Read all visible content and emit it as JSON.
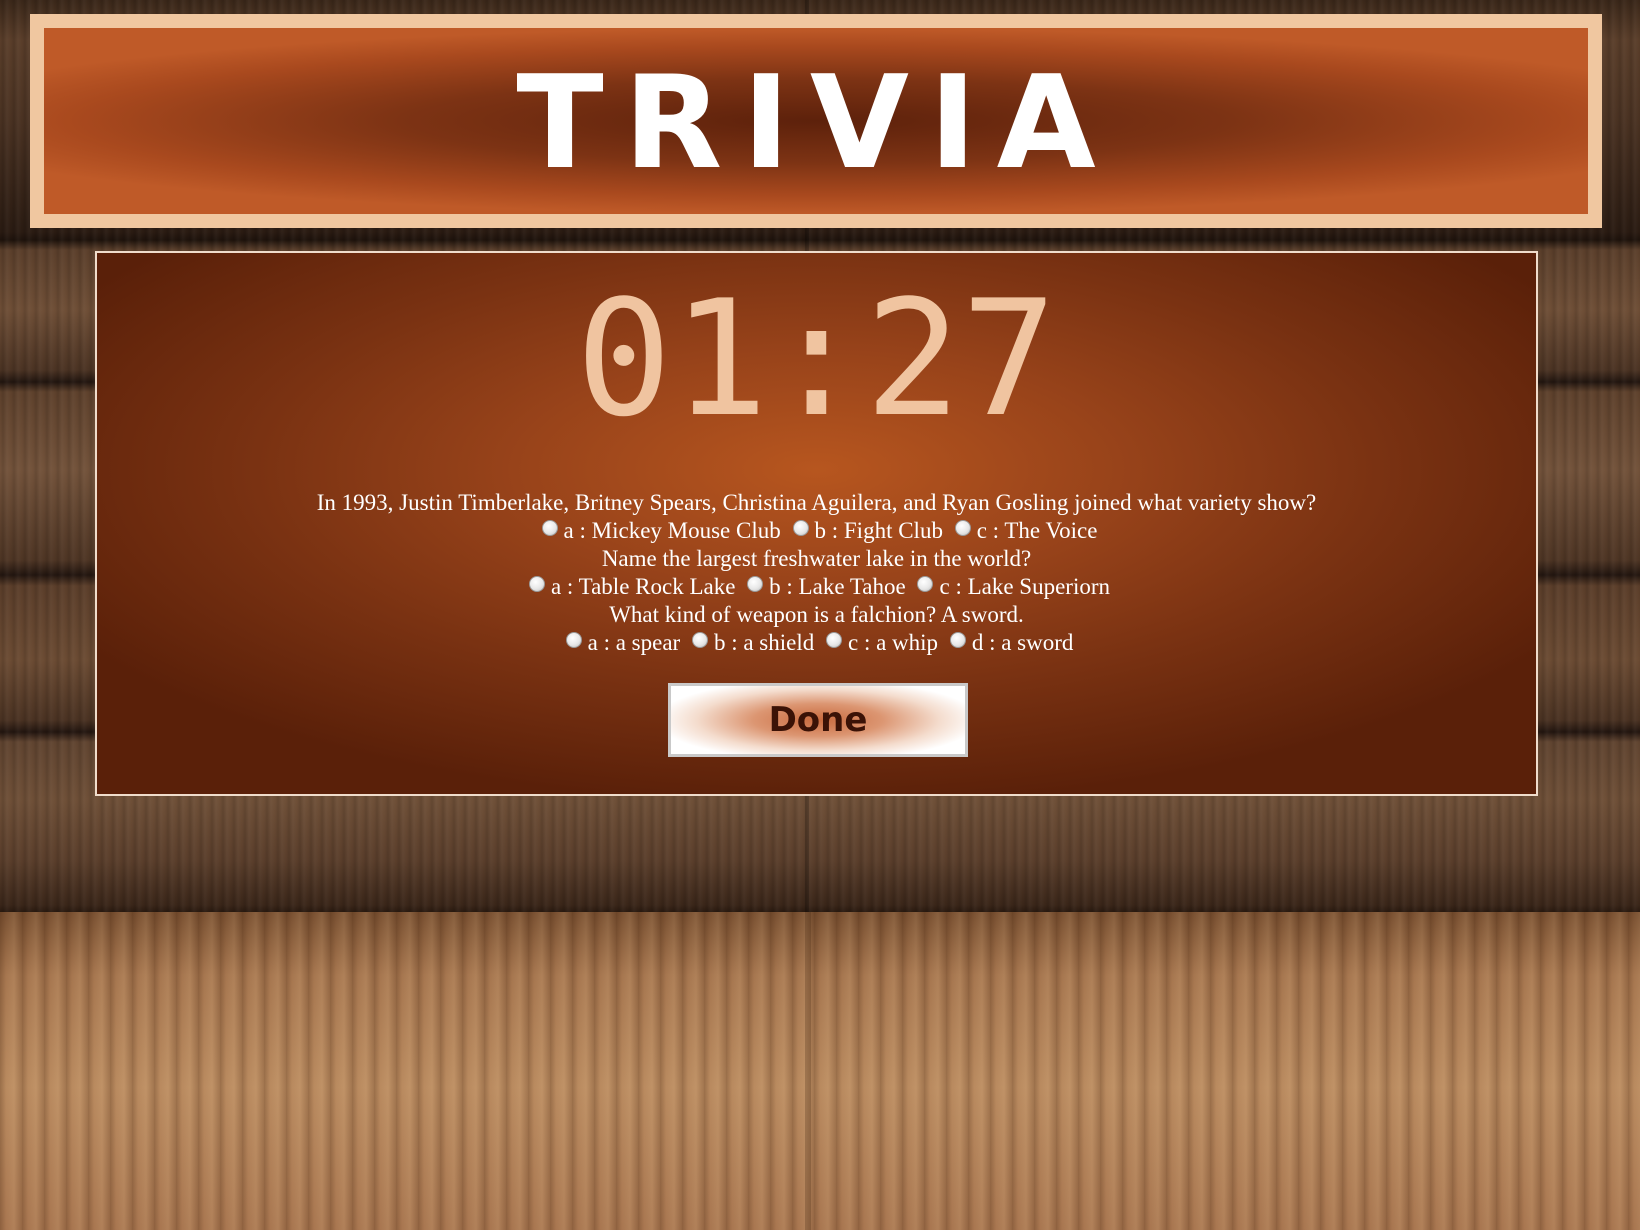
{
  "header": {
    "title": "TRIVIA"
  },
  "timer": {
    "display": "01:27"
  },
  "questions": [
    {
      "text": "In 1993, Justin Timberlake, Britney Spears, Christina Aguilera, and Ryan Gosling joined what variety show?",
      "options": [
        "a : Mickey Mouse Club",
        "b : Fight Club",
        "c : The Voice"
      ]
    },
    {
      "text": "Name the largest freshwater lake in the world?",
      "options": [
        "a : Table Rock Lake",
        "b : Lake Tahoe",
        "c : Lake Superiorn"
      ]
    },
    {
      "text": "What kind of weapon is a falchion? A sword.",
      "options": [
        "a : a spear",
        "b : a shield",
        "c : a whip",
        "d : a sword"
      ]
    }
  ],
  "actions": {
    "done_label": "Done"
  },
  "colors": {
    "header_border": "#f0c7a0",
    "panel_center": "#b7561f",
    "timer_text": "#f0c4a0"
  }
}
